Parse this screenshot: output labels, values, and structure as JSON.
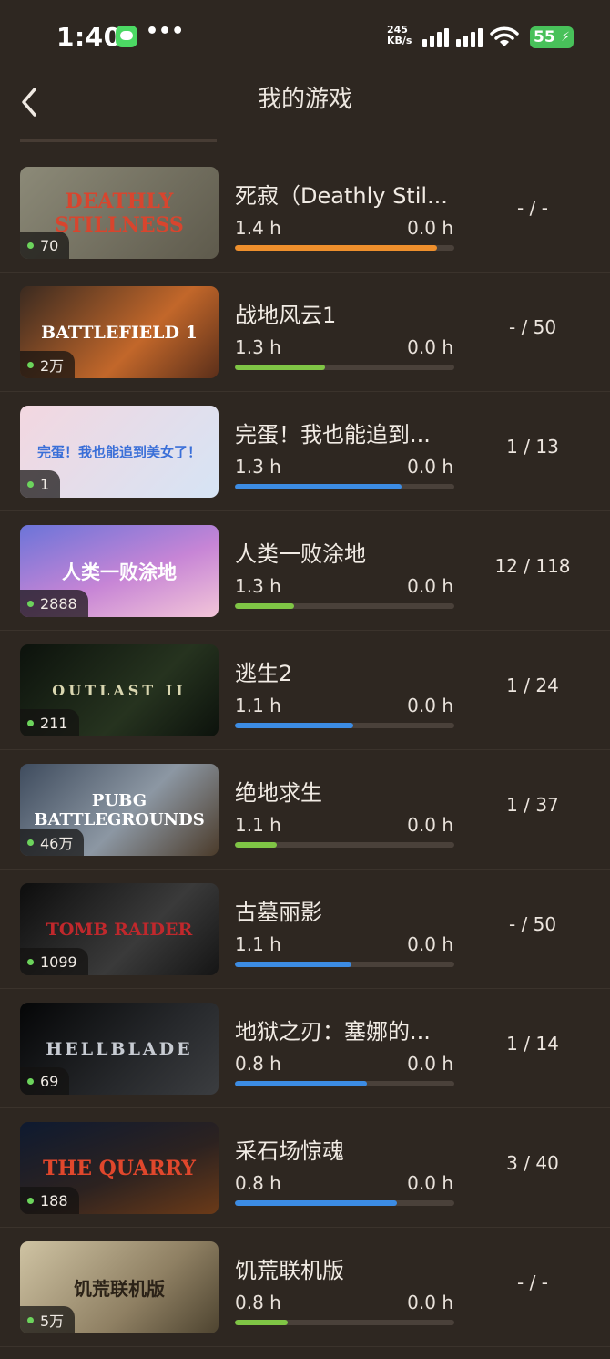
{
  "status_bar": {
    "time": "1:40",
    "dots": "•••",
    "net_speed_value": "245",
    "net_speed_unit": "KB/s",
    "battery": "55"
  },
  "header": {
    "title": "我的游戏"
  },
  "colors": {
    "orange": "#ee8f2c",
    "green": "#7fc545",
    "blue": "#3c8ce4"
  },
  "games": [
    {
      "name": "死寂（Deathly Stil...",
      "players": "70",
      "hours_total": "1.4 h",
      "hours_recent": "0.0 h",
      "achievements": "- / -",
      "progress": 0.92,
      "bar_color": "orange",
      "art_text": "DEATHLY STILLNESS"
    },
    {
      "name": "战地风云1",
      "players": "2万",
      "hours_total": "1.3 h",
      "hours_recent": "0.0 h",
      "achievements": "- / 50",
      "progress": 0.41,
      "bar_color": "green",
      "art_text": "BATTLEFIELD 1"
    },
    {
      "name": "完蛋！我也能追到...",
      "players": "1",
      "hours_total": "1.3 h",
      "hours_recent": "0.0 h",
      "achievements": "1 / 13",
      "progress": 0.76,
      "bar_color": "blue",
      "art_text": "完蛋！我也能追到美女了！"
    },
    {
      "name": "人类一败涂地",
      "players": "2888",
      "hours_total": "1.3 h",
      "hours_recent": "0.0 h",
      "achievements": "12 / 118",
      "progress": 0.27,
      "bar_color": "green",
      "art_text": "人类一败涂地"
    },
    {
      "name": "逃生2",
      "players": "211",
      "hours_total": "1.1 h",
      "hours_recent": "0.0 h",
      "achievements": "1 / 24",
      "progress": 0.54,
      "bar_color": "blue",
      "art_text": "OUTLAST II"
    },
    {
      "name": "绝地求生",
      "players": "46万",
      "hours_total": "1.1 h",
      "hours_recent": "0.0 h",
      "achievements": "1 / 37",
      "progress": 0.19,
      "bar_color": "green",
      "art_text": "PUBG BATTLEGROUNDS"
    },
    {
      "name": "古墓丽影",
      "players": "1099",
      "hours_total": "1.1 h",
      "hours_recent": "0.0 h",
      "achievements": "- / 50",
      "progress": 0.53,
      "bar_color": "blue",
      "art_text": "TOMB RAIDER"
    },
    {
      "name": "地狱之刃：塞娜的...",
      "players": "69",
      "hours_total": "0.8 h",
      "hours_recent": "0.0 h",
      "achievements": "1 / 14",
      "progress": 0.6,
      "bar_color": "blue",
      "art_text": "HELLBLADE"
    },
    {
      "name": "采石场惊魂",
      "players": "188",
      "hours_total": "0.8 h",
      "hours_recent": "0.0 h",
      "achievements": "3 / 40",
      "progress": 0.74,
      "bar_color": "blue",
      "art_text": "THE QUARRY"
    },
    {
      "name": "饥荒联机版",
      "players": "5万",
      "hours_total": "0.8 h",
      "hours_recent": "0.0 h",
      "achievements": "- / -",
      "progress": 0.24,
      "bar_color": "green",
      "art_text": "饥荒联机版"
    }
  ]
}
